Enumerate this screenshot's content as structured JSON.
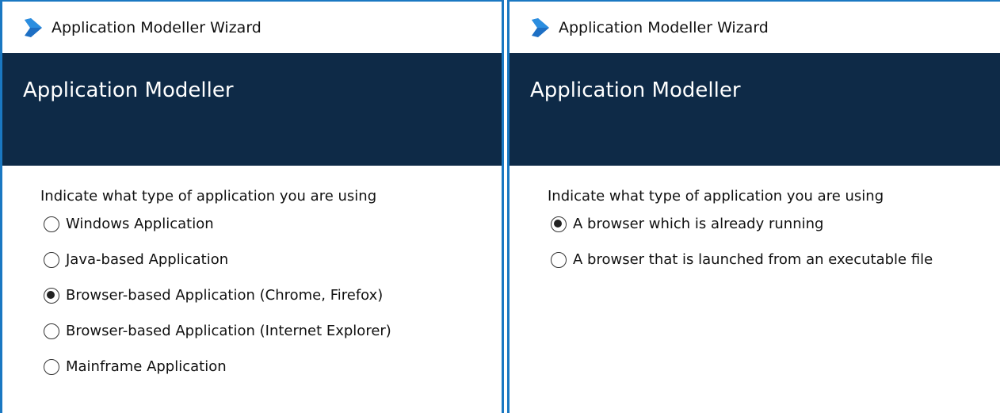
{
  "left_window": {
    "title": "Application Modeller Wizard",
    "header": "Application Modeller",
    "prompt": "Indicate what type of application you are using",
    "options": [
      {
        "label": "Windows Application",
        "selected": false
      },
      {
        "label": "Java-based Application",
        "selected": false
      },
      {
        "label": "Browser-based Application (Chrome, Firefox)",
        "selected": true
      },
      {
        "label": "Browser-based Application (Internet Explorer)",
        "selected": false
      },
      {
        "label": "Mainframe Application",
        "selected": false
      }
    ]
  },
  "right_window": {
    "title": "Application Modeller Wizard",
    "header": "Application Modeller",
    "prompt": "Indicate what type of application you are using",
    "options": [
      {
        "label": "A browser which is already running",
        "selected": true
      },
      {
        "label": "A browser that is launched from an executable file",
        "selected": false
      }
    ]
  },
  "icons": {
    "app_logo": "blue-prism-logo-icon"
  },
  "colors": {
    "window_border": "#1a78c2",
    "header_bg": "#0e2a47",
    "logo_blue": "#1d6fc4"
  }
}
